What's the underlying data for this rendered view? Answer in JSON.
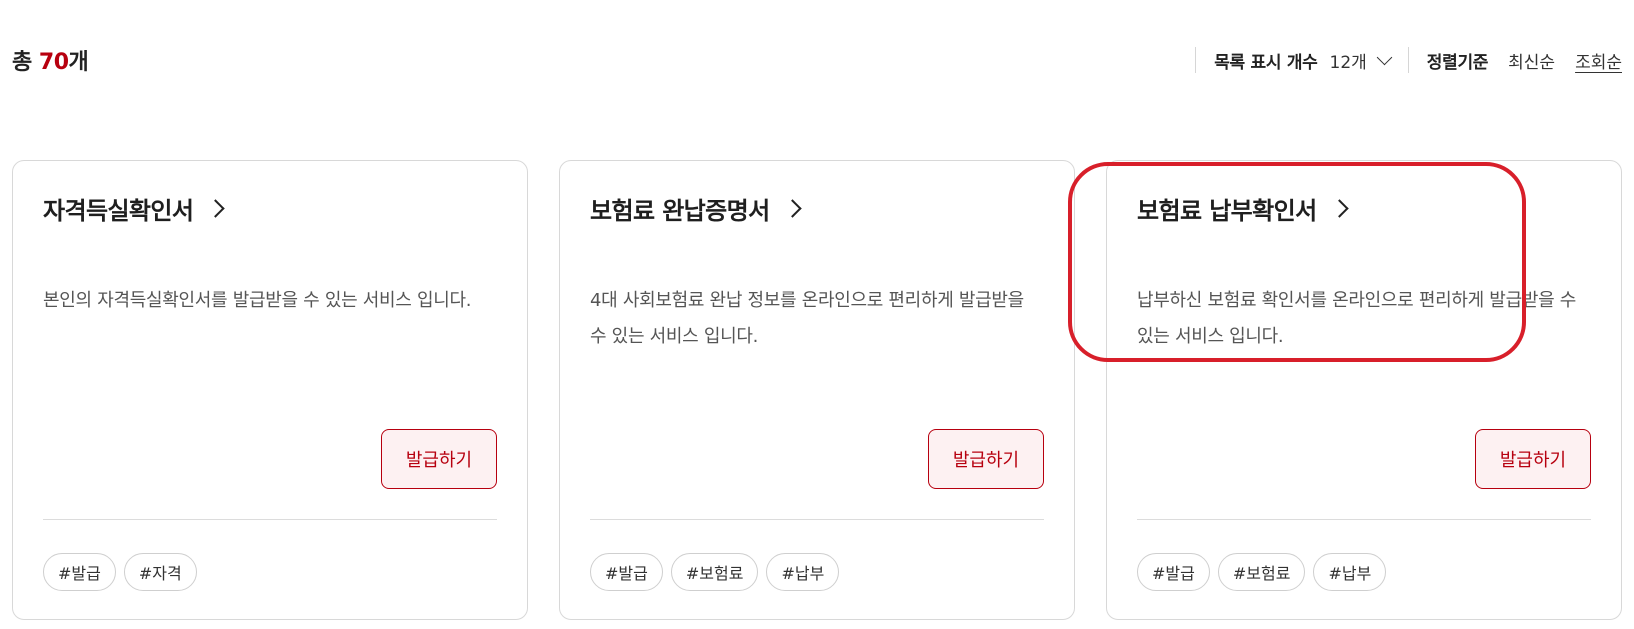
{
  "summary": {
    "prefix": "총 ",
    "count": "70",
    "suffix": "개"
  },
  "controls": {
    "count_label": "목록 표시 개수",
    "count_value": "12개",
    "sort_label": "정렬기준",
    "sort_options": [
      "최신순",
      "조회순"
    ],
    "sort_active": "조회순"
  },
  "cards": [
    {
      "title": "자격득실확인서",
      "description": "본인의 자격득실확인서를 발급받을 수 있는 서비스 입니다.",
      "button": "발급하기",
      "tags": [
        "#발급",
        "#자격"
      ]
    },
    {
      "title": "보험료 완납증명서",
      "description": "4대 사회보험료 완납 정보를 온라인으로 편리하게 발급받을 수 있는 서비스 입니다.",
      "button": "발급하기",
      "tags": [
        "#발급",
        "#보험료",
        "#납부"
      ]
    },
    {
      "title": "보험료 납부확인서",
      "description": "납부하신 보험료 확인서를 온라인으로 편리하게 발급받을 수 있는 서비스 입니다.",
      "button": "발급하기",
      "tags": [
        "#발급",
        "#보험료",
        "#납부"
      ]
    }
  ],
  "colors": {
    "accent": "#b7000f",
    "highlight": "#d81f2a",
    "button_bg": "#fdf1f2"
  },
  "icons": {
    "card_link": "chevron-right-icon",
    "dropdown": "chevron-down-icon"
  }
}
